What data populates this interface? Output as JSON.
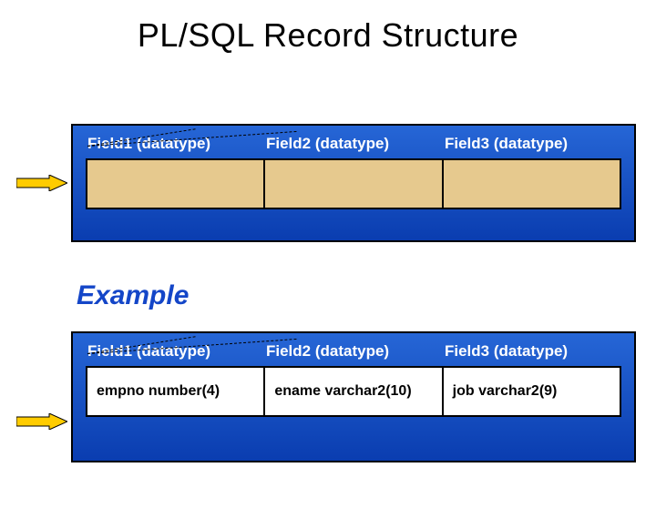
{
  "title": "PL/SQL Record Structure",
  "example_label": "Example",
  "headers": {
    "h1": "Field1 (datatype)",
    "h2": "Field2 (datatype)",
    "h3": "Field3 (datatype)"
  },
  "example": {
    "c1": "empno  number(4)",
    "c2": "ename  varchar2(10)",
    "c3": "job  varchar2(9)"
  },
  "colors": {
    "panel_grad_top": "#2666d6",
    "panel_grad_bot": "#0a3db0",
    "blank_fill": "#e6c98e",
    "arrow": "#ffcc00",
    "title_accent": "#1446c8"
  }
}
